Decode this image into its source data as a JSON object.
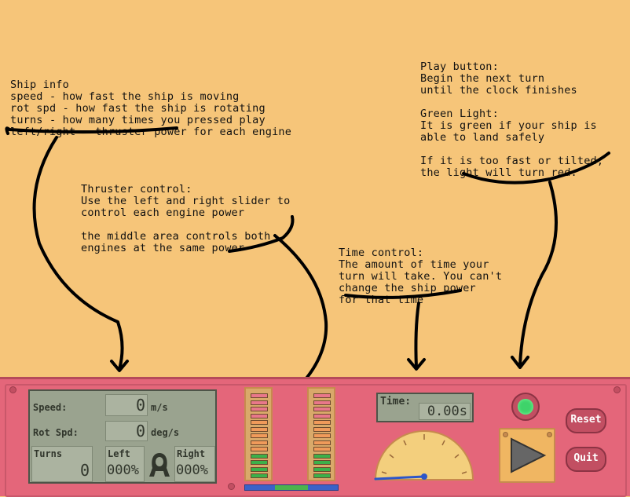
{
  "notes": {
    "ship_info": [
      "Ship info",
      "speed - how fast the ship is moving",
      "rot spd - how fast the ship is rotating",
      "turns - how many times you pressed play",
      "left/right - thruster power for each engine"
    ],
    "thruster_control": [
      "Thruster control:",
      "Use the left and right slider to",
      "control each engine power",
      "",
      "the middle area controls both",
      "engines at the same power"
    ],
    "time_control": [
      "Time control:",
      "The amount of time your",
      "turn will take. You can't",
      "change the ship power",
      "for that time"
    ],
    "play_button": [
      "Play button:",
      "Begin the next turn",
      "until the clock finishes",
      "",
      "Green Light:",
      "It is green if your ship is",
      "able to land safely",
      "",
      "If it is too fast or tilted,",
      "the light will turn red."
    ]
  },
  "ship_info": {
    "speed_label": "Speed:",
    "speed_value": "0",
    "speed_unit": "m/s",
    "rot_label": "Rot Spd:",
    "rot_value": "0",
    "rot_unit": "deg/s",
    "turns_label": "Turns",
    "turns_value": "0",
    "left_label": "Left",
    "left_value": "000%",
    "right_label": "Right",
    "right_value": "000%"
  },
  "time": {
    "label": "Time:",
    "value": "0.00s"
  },
  "buttons": {
    "reset": "Reset",
    "quit": "Quit"
  },
  "thrusters": {
    "left_level": 0,
    "right_level": 0
  },
  "status_light": "green",
  "colors": {
    "background": "#f6c579",
    "panel": "#e4667a",
    "lcd": "#9aa38f",
    "light_green": "#3fd36a",
    "segment_pink": "#e8778a",
    "segment_orange": "#f09a5a",
    "segment_green": "#3cb04a"
  }
}
